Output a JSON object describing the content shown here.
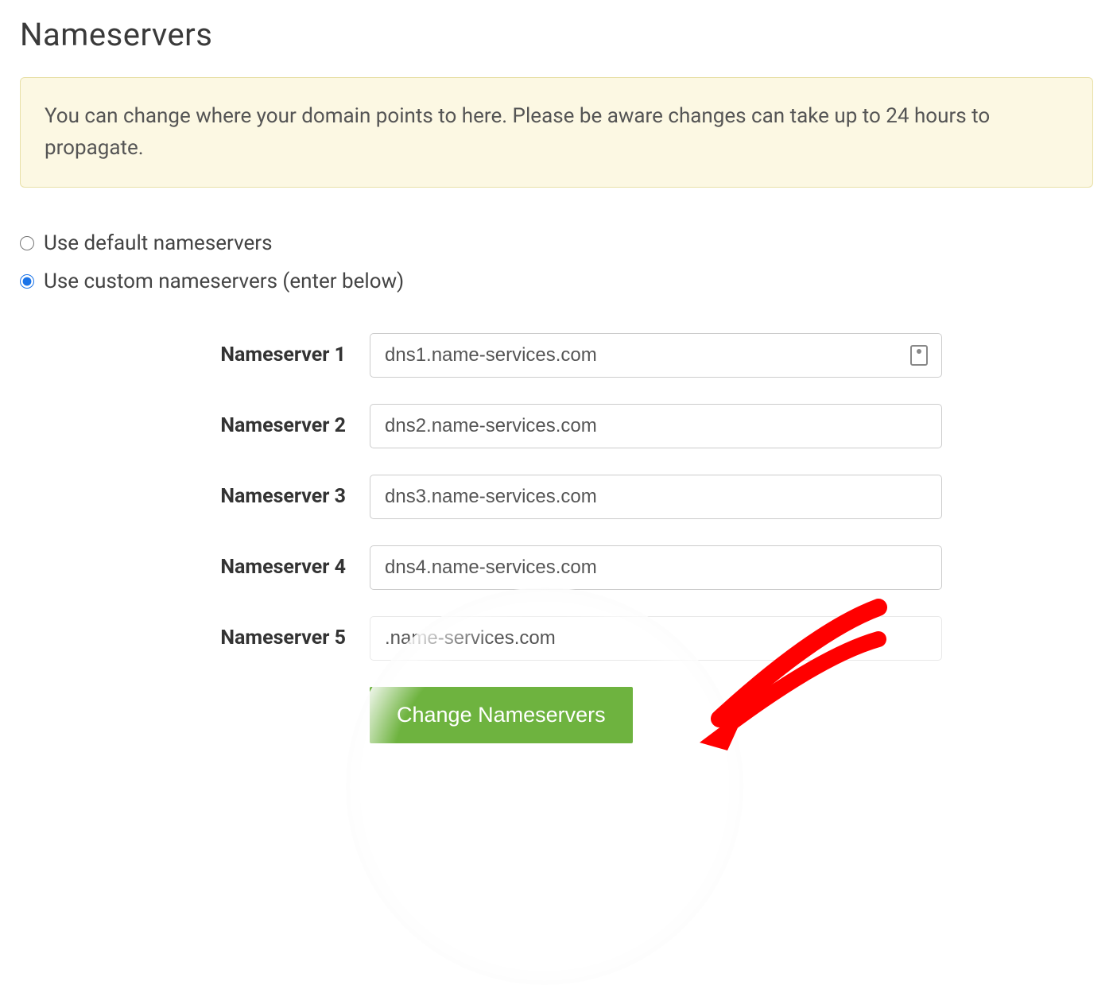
{
  "page": {
    "title": "Nameservers",
    "info": "You can change where your domain points to here. Please be aware changes can take up to 24 hours to propagate."
  },
  "radios": {
    "default_label": "Use default nameservers",
    "custom_label": "Use custom nameservers (enter below)"
  },
  "form": {
    "fields": [
      {
        "label": "Nameserver 1",
        "value": "dns1.name-services.com"
      },
      {
        "label": "Nameserver 2",
        "value": "dns2.name-services.com"
      },
      {
        "label": "Nameserver 3",
        "value": "dns3.name-services.com"
      },
      {
        "label": "Nameserver 4",
        "value": "dns4.name-services.com"
      },
      {
        "label": "Nameserver 5",
        "value": ".name-services.com"
      }
    ],
    "submit_label": "Change Nameservers"
  }
}
